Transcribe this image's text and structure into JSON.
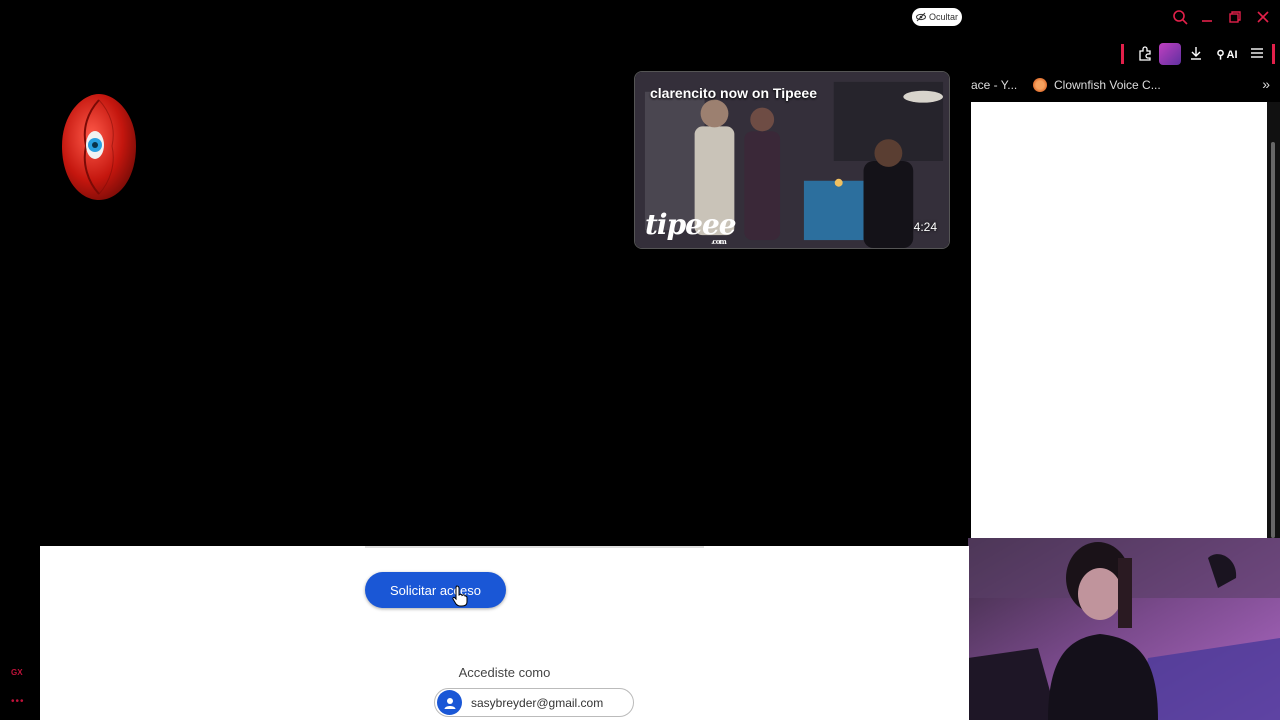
{
  "overlay": {
    "hide_label": "Ocultar"
  },
  "tipeee_card": {
    "title": "clarencito now on Tipeee",
    "logo_text": "tipeee",
    "logo_sub": ".com",
    "duration": "4:24"
  },
  "browser": {
    "bookmarks": [
      {
        "label": "ace - Y..."
      },
      {
        "label": "Clownfish Voice C..."
      }
    ],
    "toolbar_ai_label": "AI"
  },
  "request_access": {
    "button_label": "Solicitar acceso",
    "signed_in_label": "Accediste como",
    "email": "sasybreyder@gmail.com"
  },
  "sidebar_brand": {
    "gx_label": "GX",
    "more_label": "•••"
  },
  "colors": {
    "accent_red": "#e2204a",
    "button_blue": "#1a57d6"
  }
}
